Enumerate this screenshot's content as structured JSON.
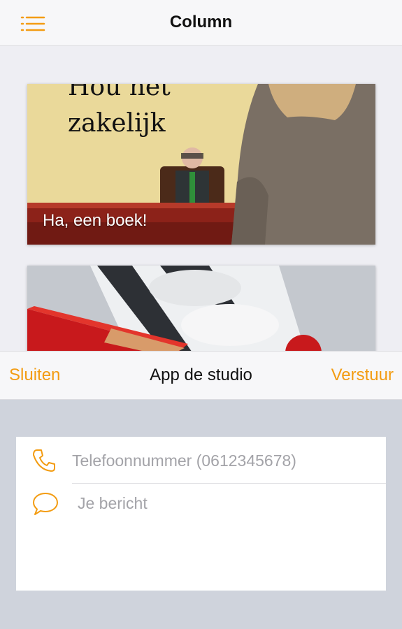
{
  "header": {
    "title": "Column",
    "menu_icon": "list-icon"
  },
  "cards": [
    {
      "book_title_line1": "Hou het",
      "book_title_line2": "zakelijk",
      "caption": "Ha, een boek!"
    },
    {
      "caption": ""
    }
  ],
  "sheet": {
    "close_label": "Sluiten",
    "title": "App de studio",
    "send_label": "Verstuur",
    "phone_placeholder": "Telefoonnummer (0612345678)",
    "message_placeholder": "Je bericht",
    "phone_icon": "phone-icon",
    "message_icon": "chat-bubble-icon"
  },
  "colors": {
    "accent": "#f39c12",
    "sheet_background": "#cfd3dc",
    "bar_background": "#f7f7f9"
  }
}
